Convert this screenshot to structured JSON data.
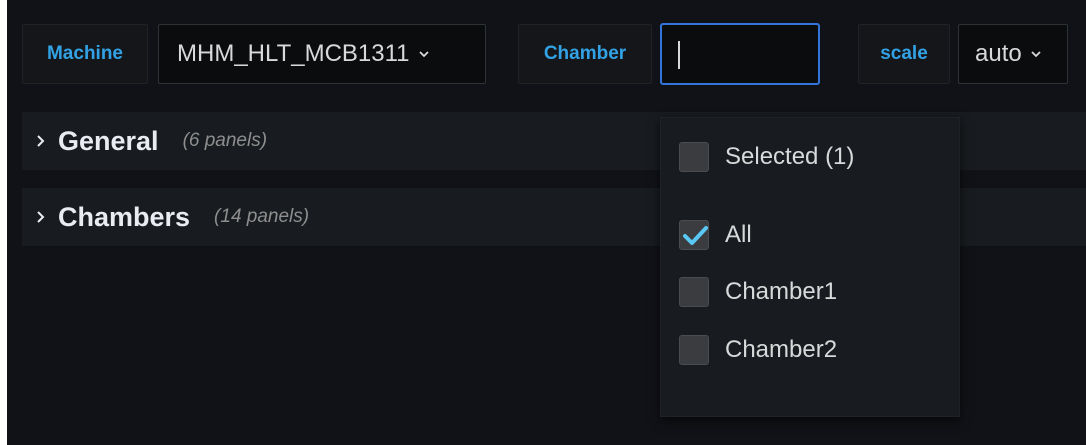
{
  "variables": {
    "machine": {
      "label": "Machine",
      "value": "MHM_HLT_MCB1311"
    },
    "chamber": {
      "label": "Chamber",
      "input_value": ""
    },
    "scale": {
      "label": "scale",
      "value": "auto"
    }
  },
  "rows": [
    {
      "title": "General",
      "count": "(6 panels)"
    },
    {
      "title": "Chambers",
      "count": "(14 panels)"
    }
  ],
  "dropdown": {
    "selected_toggle": "Selected (1)",
    "options": [
      {
        "label": "All",
        "checked": true
      },
      {
        "label": "Chamber1",
        "checked": false
      },
      {
        "label": "Chamber2",
        "checked": false
      }
    ]
  },
  "colors": {
    "accent_blue": "#33a2e5",
    "focus_border": "#3274d9",
    "check_mark": "#5ac8f5",
    "background": "#111217",
    "row_background": "#181b1f"
  },
  "icons": {
    "select_chevron": "chevron-down-icon",
    "row_chevron": "chevron-right-icon",
    "checkbox_checked": "check-icon"
  }
}
